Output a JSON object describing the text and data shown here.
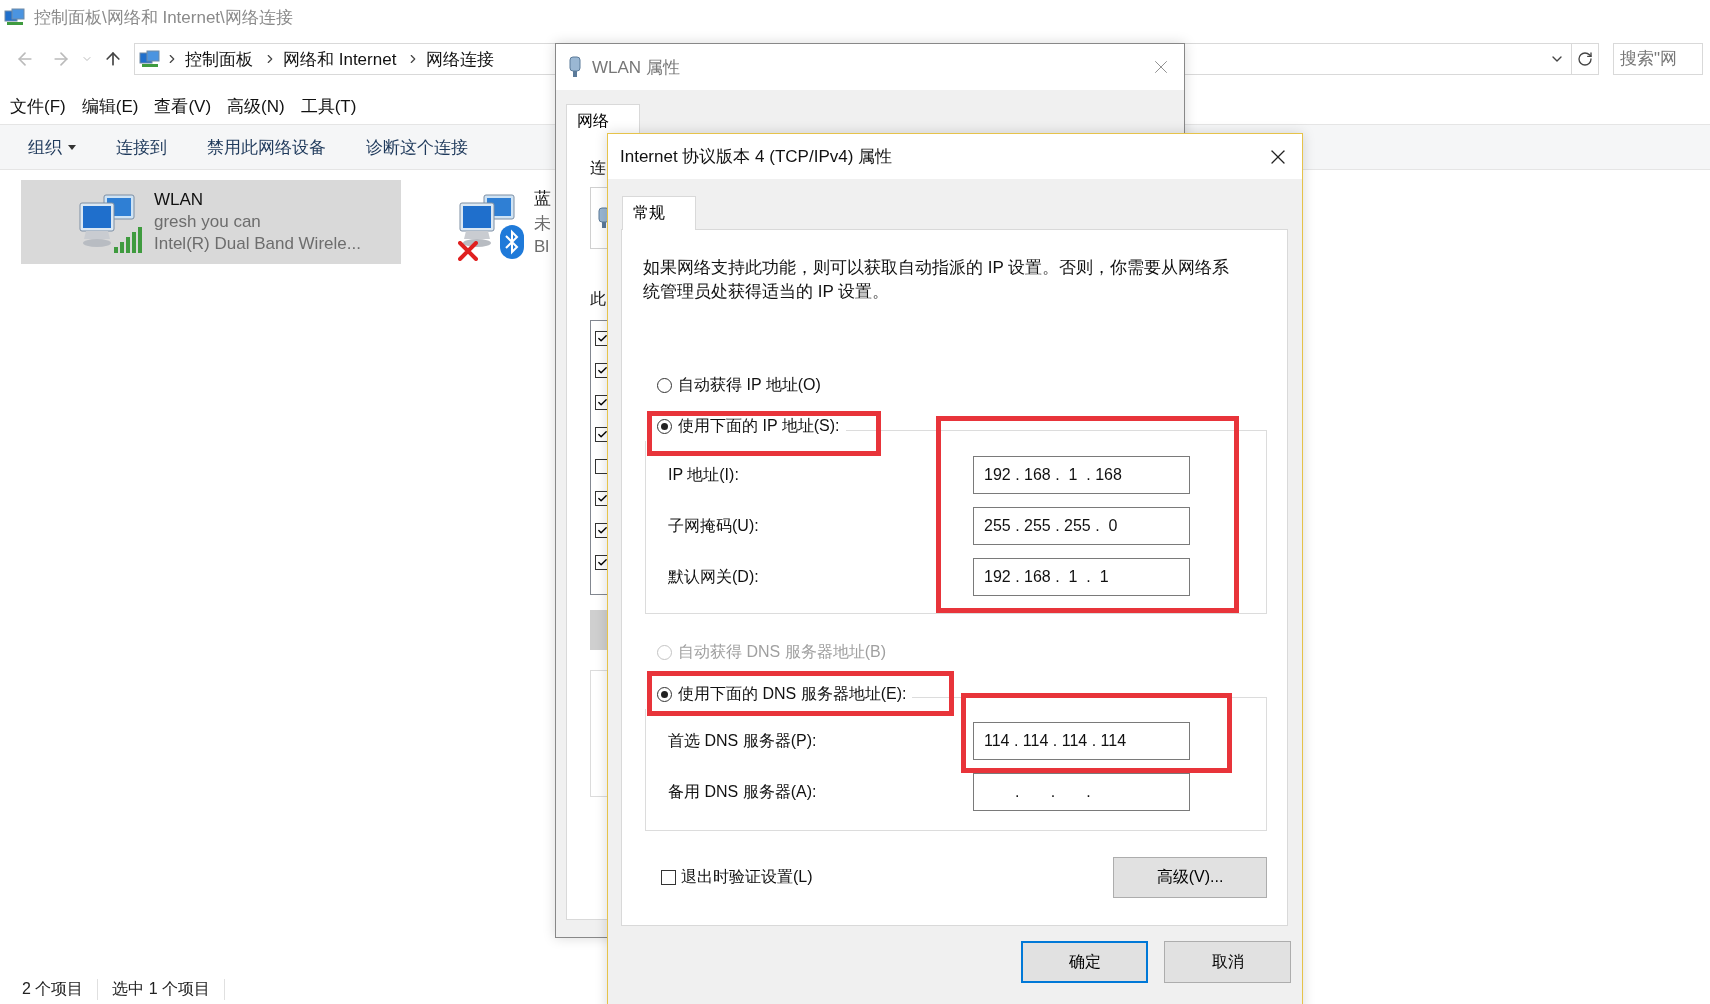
{
  "explorer": {
    "title": "控制面板\\网络和 Internet\\网络连接",
    "breadcrumb": [
      "控制面板",
      "网络和 Internet",
      "网络连接"
    ],
    "search": {
      "placeholder": "搜索\"网"
    },
    "menu": [
      "文件(F)",
      "编辑(E)",
      "查看(V)",
      "高级(N)",
      "工具(T)"
    ],
    "toolbar": [
      {
        "label": "组织",
        "kind": "menu"
      },
      {
        "label": "连接到",
        "kind": "plain"
      },
      {
        "label": "禁用此网络设备",
        "kind": "plain"
      },
      {
        "label": "诊断这个连接",
        "kind": "plain"
      }
    ],
    "connections": [
      {
        "name": "WLAN",
        "status": "gresh you can",
        "device": "Intel(R) Dual Band Wirele...",
        "kind": "wifi",
        "selected": true
      },
      {
        "name": "蓝",
        "status": "未",
        "device": "Bl",
        "kind": "bluetooth",
        "selected": false
      }
    ],
    "status_bar": [
      "2 个项目",
      "选中 1 个项目"
    ]
  },
  "wlan_dialog": {
    "title": "WLAN 属性",
    "tabs": [
      {
        "label": "网络",
        "selected": true
      }
    ],
    "connect_label": "连",
    "list_label": "此",
    "components": [
      {
        "checked": true
      },
      {
        "checked": true
      },
      {
        "checked": true
      },
      {
        "checked": true
      },
      {
        "checked": false
      },
      {
        "checked": true
      },
      {
        "checked": true
      },
      {
        "checked": true
      }
    ]
  },
  "ipv4_dialog": {
    "title": "Internet 协议版本 4 (TCP/IPv4) 属性",
    "tabs": [
      {
        "label": "常规",
        "selected": true
      }
    ],
    "description": "如果网络支持此功能，则可以获取自动指派的 IP 设置。否则，你需要从网络系统管理员处获得适当的 IP 设置。",
    "ip_mode": [
      {
        "label": "自动获得 IP 地址(O)",
        "selected": false,
        "disabled": false
      },
      {
        "label": "使用下面的 IP 地址(S):",
        "selected": true,
        "disabled": false
      }
    ],
    "ip_fields": [
      {
        "label": "IP 地址(I):",
        "value": "192 . 168 .  1  . 168"
      },
      {
        "label": "子网掩码(U):",
        "value": "255 . 255 . 255 .  0"
      },
      {
        "label": "默认网关(D):",
        "value": "192 . 168 .  1  .  1"
      }
    ],
    "dns_mode": [
      {
        "label": "自动获得 DNS 服务器地址(B)",
        "selected": false,
        "disabled": true
      },
      {
        "label": "使用下面的 DNS 服务器地址(E):",
        "selected": true,
        "disabled": false
      }
    ],
    "dns_fields": [
      {
        "label": "首选 DNS 服务器(P):",
        "value": "114 . 114 . 114 . 114"
      },
      {
        "label": "备用 DNS 服务器(A):",
        "value": "       .       .       ."
      }
    ],
    "validate": {
      "label": "退出时验证设置(L)",
      "checked": false
    },
    "advanced_button": "高级(V)...",
    "buttons": [
      {
        "label": "确定",
        "default": true
      },
      {
        "label": "取消",
        "default": false
      }
    ]
  }
}
